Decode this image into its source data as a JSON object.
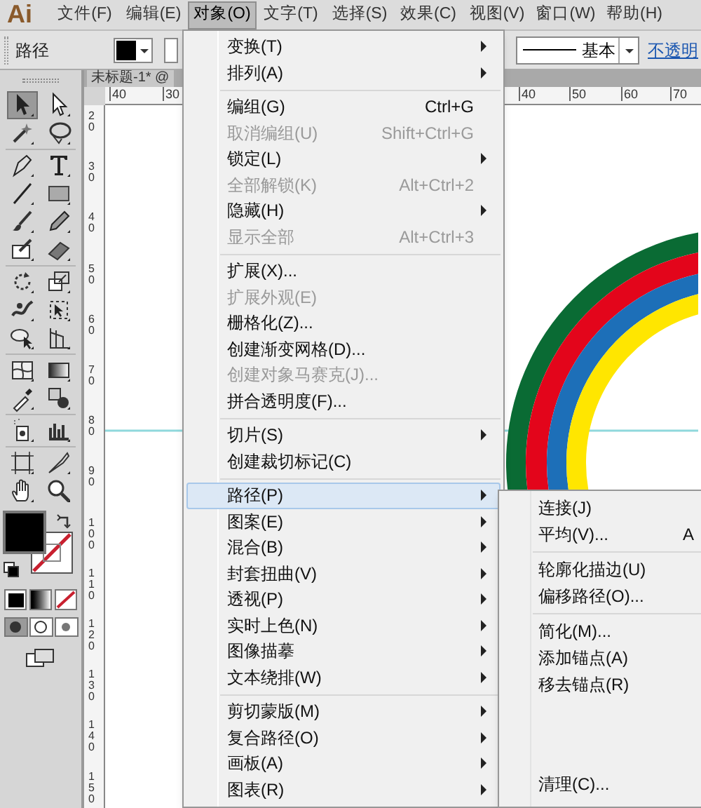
{
  "app_logo": "Ai",
  "menu_bar": [
    {
      "label": "文件(F)",
      "selected": false
    },
    {
      "label": "编辑(E)",
      "selected": false
    },
    {
      "label": "对象(O)",
      "selected": true
    },
    {
      "label": "文字(T)",
      "selected": false
    },
    {
      "label": "选择(S)",
      "selected": false
    },
    {
      "label": "效果(C)",
      "selected": false
    },
    {
      "label": "视图(V)",
      "selected": false
    },
    {
      "label": "窗口(W)",
      "selected": false
    },
    {
      "label": "帮助(H)",
      "selected": false
    }
  ],
  "control_bar": {
    "label": "路径",
    "stroke_style": "基本",
    "opacity_link": "不透明"
  },
  "document_tab": "未标题-1* @",
  "rulers": {
    "horizontal": [
      {
        "label": "40"
      },
      {
        "label": "30"
      },
      {
        "label": "40"
      },
      {
        "label": "50"
      },
      {
        "label": "60"
      },
      {
        "label": "70"
      }
    ],
    "vertical": [
      "20",
      "30",
      "40",
      "50",
      "60",
      "70",
      "80",
      "90",
      "100",
      "110",
      "120",
      "130",
      "140",
      "150"
    ]
  },
  "tools": [
    {
      "kind": "selection",
      "selected": true
    },
    {
      "kind": "direct-selection",
      "selected": false
    },
    {
      "kind": "magic-wand",
      "selected": false
    },
    {
      "kind": "lasso",
      "selected": false
    },
    {
      "kind": "pen",
      "selected": false
    },
    {
      "kind": "type",
      "selected": false
    },
    {
      "kind": "line",
      "selected": false
    },
    {
      "kind": "rectangle",
      "selected": false
    },
    {
      "kind": "brush",
      "selected": false
    },
    {
      "kind": "pencil",
      "selected": false
    },
    {
      "kind": "blob-brush",
      "selected": false
    },
    {
      "kind": "eraser",
      "selected": false
    },
    {
      "kind": "rotate",
      "selected": false
    },
    {
      "kind": "scale",
      "selected": false
    },
    {
      "kind": "warp",
      "selected": false
    },
    {
      "kind": "free-transform",
      "selected": false
    },
    {
      "kind": "shape-builder",
      "selected": false
    },
    {
      "kind": "perspective",
      "selected": false
    },
    {
      "kind": "mesh",
      "selected": false
    },
    {
      "kind": "gradient",
      "selected": false
    },
    {
      "kind": "eyedropper",
      "selected": false
    },
    {
      "kind": "blend",
      "selected": false
    },
    {
      "kind": "sprayer",
      "selected": false
    },
    {
      "kind": "graph",
      "selected": false
    },
    {
      "kind": "artboard",
      "selected": false
    },
    {
      "kind": "slice",
      "selected": false
    },
    {
      "kind": "hand",
      "selected": false
    },
    {
      "kind": "zoom",
      "selected": false
    }
  ],
  "object_menu": [
    [
      {
        "label": "变换(T)",
        "submenu": true,
        "disabled": false,
        "selected": false
      },
      {
        "label": "排列(A)",
        "submenu": true,
        "disabled": false,
        "selected": false
      }
    ],
    [
      {
        "label": "编组(G)",
        "shortcut": "Ctrl+G",
        "submenu": false,
        "disabled": false,
        "selected": false
      },
      {
        "label": "取消编组(U)",
        "shortcut": "Shift+Ctrl+G",
        "submenu": false,
        "disabled": true,
        "selected": false
      },
      {
        "label": "锁定(L)",
        "submenu": true,
        "disabled": false,
        "selected": false
      },
      {
        "label": "全部解锁(K)",
        "shortcut": "Alt+Ctrl+2",
        "submenu": false,
        "disabled": true,
        "selected": false
      },
      {
        "label": "隐藏(H)",
        "submenu": true,
        "disabled": false,
        "selected": false
      },
      {
        "label": "显示全部",
        "shortcut": "Alt+Ctrl+3",
        "submenu": false,
        "disabled": true,
        "selected": false
      }
    ],
    [
      {
        "label": "扩展(X)...",
        "submenu": false,
        "disabled": false,
        "selected": false
      },
      {
        "label": "扩展外观(E)",
        "submenu": false,
        "disabled": true,
        "selected": false
      },
      {
        "label": "栅格化(Z)...",
        "submenu": false,
        "disabled": false,
        "selected": false
      },
      {
        "label": "创建渐变网格(D)...",
        "submenu": false,
        "disabled": false,
        "selected": false
      },
      {
        "label": "创建对象马赛克(J)...",
        "submenu": false,
        "disabled": true,
        "selected": false
      },
      {
        "label": "拼合透明度(F)...",
        "submenu": false,
        "disabled": false,
        "selected": false
      }
    ],
    [
      {
        "label": "切片(S)",
        "submenu": true,
        "disabled": false,
        "selected": false
      },
      {
        "label": "创建裁切标记(C)",
        "submenu": false,
        "disabled": false,
        "selected": false
      }
    ],
    [
      {
        "label": "路径(P)",
        "submenu": true,
        "disabled": false,
        "selected": true
      },
      {
        "label": "图案(E)",
        "submenu": true,
        "disabled": false,
        "selected": false
      },
      {
        "label": "混合(B)",
        "submenu": true,
        "disabled": false,
        "selected": false
      },
      {
        "label": "封套扭曲(V)",
        "submenu": true,
        "disabled": false,
        "selected": false
      },
      {
        "label": "透视(P)",
        "submenu": true,
        "disabled": false,
        "selected": false
      },
      {
        "label": "实时上色(N)",
        "submenu": true,
        "disabled": false,
        "selected": false
      },
      {
        "label": "图像描摹",
        "submenu": true,
        "disabled": false,
        "selected": false
      },
      {
        "label": "文本绕排(W)",
        "submenu": true,
        "disabled": false,
        "selected": false
      }
    ],
    [
      {
        "label": "剪切蒙版(M)",
        "submenu": true,
        "disabled": false,
        "selected": false
      },
      {
        "label": "复合路径(O)",
        "submenu": true,
        "disabled": false,
        "selected": false
      },
      {
        "label": "画板(A)",
        "submenu": true,
        "disabled": false,
        "selected": false
      },
      {
        "label": "图表(R)",
        "submenu": true,
        "disabled": false,
        "selected": false
      }
    ]
  ],
  "path_submenu": [
    [
      {
        "label": "连接(J)"
      },
      {
        "label": "平均(V)...",
        "shortcut": "A"
      }
    ],
    [
      {
        "label": "轮廓化描边(U)"
      },
      {
        "label": "偏移路径(O)..."
      }
    ],
    [
      {
        "label": "简化(M)..."
      },
      {
        "label": "添加锚点(A)"
      },
      {
        "label": "移去锚点(R)"
      },
      {
        "kind": "hidden"
      },
      {
        "label": "清理(C)..."
      }
    ]
  ]
}
